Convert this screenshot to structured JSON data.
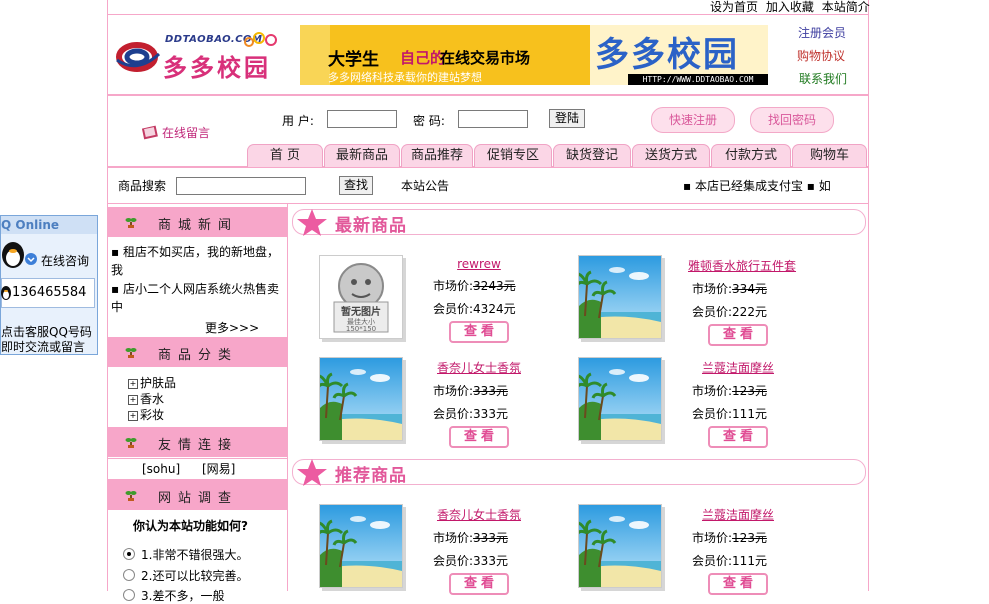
{
  "toplinks": {
    "home": "设为首页",
    "favorite": "加入收藏",
    "about": "本站简介"
  },
  "logo": {
    "en": "DDTAOBAO.COM",
    "cn": "多多校园"
  },
  "banner": {
    "line1": "大学生",
    "line2": "自己的",
    "line3": "在线交易市场",
    "brand": "多多校园",
    "slogan": "多多网络科技承载你的建站梦想",
    "url": "HTTP://WWW.DDTAOBAO.COM"
  },
  "rightlinks": {
    "register": "注册会员",
    "agreement": "购物协议",
    "contact": "联系我们"
  },
  "login": {
    "guestbook": "在线留言",
    "user_label": "用 户:",
    "pwd_label": "密 码:",
    "login_btn": "登陆",
    "quick_register": "快速注册",
    "find_password": "找回密码"
  },
  "nav": [
    "首 页",
    "最新商品",
    "商品推荐",
    "促销专区",
    "缺货登记",
    "送货方式",
    "付款方式",
    "购物车"
  ],
  "search": {
    "label": "商品搜索",
    "button": "查找",
    "notice_label": "本站公告",
    "marquee": "▪ 本店已经集成支付宝 ▪ 如"
  },
  "qq": {
    "title": "Q Online",
    "consult": "在线咨询",
    "number": "136465584",
    "tip1": "点击客服QQ号码",
    "tip2": "即时交流或留言"
  },
  "sidebar": {
    "news_title": "商城新闻",
    "news": [
      "▪ 租店不如买店，我的新地盘，我",
      "▪ 店小二个人网店系统火热售卖中"
    ],
    "more": "更多>>>",
    "category_title": "商品分类",
    "categories": [
      "护肤品",
      "香水",
      "彩妆"
    ],
    "links_title": "友情连接",
    "links": [
      "[sohu]",
      "[网易]"
    ],
    "poll_title": "网站调查",
    "poll_question": "你认为本站功能如何?",
    "poll_options": [
      "1.非常不错很强大。",
      "2.还可以比较完善。",
      "3.差不多，一般"
    ]
  },
  "sections": {
    "newest": "最新商品",
    "recommended": "推荐商品"
  },
  "labels": {
    "market": "市场价:",
    "member": "会员价:",
    "view": "查看",
    "no_image": "暂无图片",
    "no_image_hint": "最佳大小",
    "no_image_size": "150*150"
  },
  "products_new": [
    {
      "name": "rewrew",
      "market": "3243元",
      "member": "4324元",
      "image": "no-image"
    },
    {
      "name": "雅顿香水旅行五件套",
      "market": "334元",
      "member": "222元",
      "image": "beach"
    },
    {
      "name": "香奈儿女士香氛",
      "market": "333元",
      "member": "333元",
      "image": "beach"
    },
    {
      "name": "兰蔻洁面摩丝",
      "market": "123元",
      "member": "111元",
      "image": "beach"
    }
  ],
  "products_rec": [
    {
      "name": "香奈儿女士香氛",
      "market": "333元",
      "member": "333元",
      "image": "beach"
    },
    {
      "name": "兰蔻洁面摩丝",
      "market": "123元",
      "member": "111元",
      "image": "beach"
    }
  ],
  "colors": {
    "pink_border": "#f6a7c9",
    "pink_fill": "#f7a6c9",
    "accent": "#e2589a",
    "banner_bg": "#f7c11d"
  }
}
